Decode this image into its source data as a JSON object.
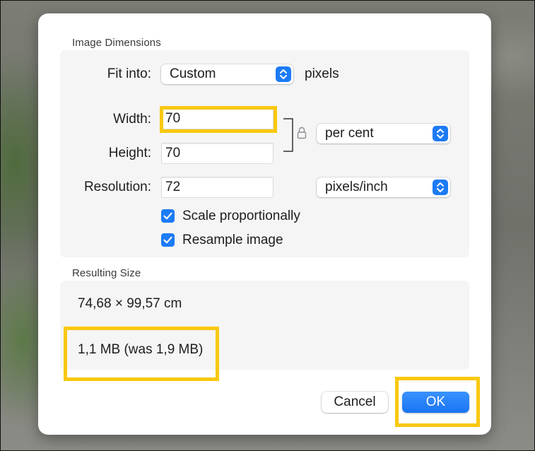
{
  "dialog": {
    "image_dimensions": {
      "section_title": "Image Dimensions",
      "fit_into_label": "Fit into:",
      "fit_into_value": "Custom",
      "fit_into_unit": "pixels",
      "width_label": "Width:",
      "width_value": "70",
      "height_label": "Height:",
      "height_value": "70",
      "size_unit_value": "per cent",
      "resolution_label": "Resolution:",
      "resolution_value": "72",
      "resolution_unit_value": "pixels/inch",
      "scale_proportionally_label": "Scale proportionally",
      "scale_proportionally_checked": true,
      "resample_label": "Resample image",
      "resample_checked": true
    },
    "resulting_size": {
      "section_title": "Resulting Size",
      "dimensions_text": "74,68 × 99,57 cm",
      "file_size_text": "1,1 MB (was 1,9 MB)"
    },
    "buttons": {
      "cancel_label": "Cancel",
      "ok_label": "OK"
    }
  },
  "colors": {
    "accent": "#1c7bf5",
    "highlight": "#f9c80e"
  },
  "icons": {
    "lock": "lock-icon",
    "stepper": "up-down-chevron-icon",
    "checkbox": "checkmark-icon"
  }
}
